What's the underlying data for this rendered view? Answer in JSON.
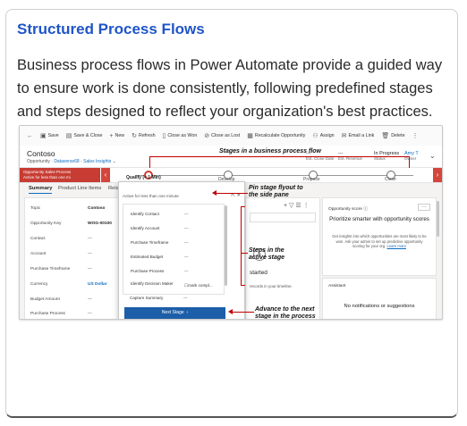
{
  "card": {
    "title": "Structured Process Flows",
    "body": "Business process flows in Power Automate provide a guided way to ensure work is done consistently, following predefined stages and steps designed to reflect your organization's best practices."
  },
  "commandbar": {
    "items": [
      "Save",
      "Save & Close",
      "New",
      "Refresh",
      "Close as Won",
      "Close as Lost",
      "Recalculate Opportunity",
      "Assign",
      "Email a Link",
      "Delete"
    ]
  },
  "record": {
    "name": "Contoso",
    "entity": "Opportunity",
    "form": "Dataverse68 - Sales Insights",
    "est_close_label": "Est. Close Date",
    "est_close_value": "---",
    "est_revenue_label": "Est. Revenue",
    "est_revenue_value": "---",
    "status_label": "Status",
    "status_value": "In Progress",
    "owner_label": "Owner",
    "owner_value": "Amy T"
  },
  "process": {
    "name": "Opportunity Sales Process",
    "active_time": "Active for less than one mi",
    "stages": [
      {
        "label": "Qualify (< 1 Min)",
        "active": true
      },
      {
        "label": "Develop",
        "active": false
      },
      {
        "label": "Propose",
        "active": false
      },
      {
        "label": "Close",
        "active": false
      }
    ]
  },
  "tabs": [
    "Summary",
    "Product Line Items",
    "Relate"
  ],
  "form_fields": [
    {
      "label": "Topic",
      "value": "Contoso"
    },
    {
      "label": "Opportunity Key",
      "value": "WOG-00100"
    },
    {
      "label": "Contact",
      "value": "---"
    },
    {
      "label": "Account",
      "value": "---"
    },
    {
      "label": "Purchase Timeframe",
      "value": "---"
    },
    {
      "label": "Currency",
      "value": "US Dollar"
    },
    {
      "label": "Budget Amount",
      "value": "---"
    },
    {
      "label": "Purchase Process",
      "value": "---"
    }
  ],
  "flyout": {
    "active_time": "Active for less than one minute",
    "steps": [
      {
        "label": "Identify Contact",
        "value": "---"
      },
      {
        "label": "Identify Account",
        "value": "---"
      },
      {
        "label": "Purchase Timeframe",
        "value": "---"
      },
      {
        "label": "Estimated Budget",
        "value": "---"
      },
      {
        "label": "Purchase Process",
        "value": "---"
      },
      {
        "label": "Identify Decision Maker",
        "value": "mark compl..."
      },
      {
        "label": "Capture Summary",
        "value": "---"
      }
    ],
    "next_button": "Next Stage"
  },
  "middle": {
    "started": "started",
    "records_text": "records in your timeline."
  },
  "right_panel": {
    "score_title": "Opportunity score",
    "headline": "Prioritize smarter with opportunity scores",
    "body": "Get insights into which opportunities are most likely to be won. Ask your admin to set up predictive opportunity scoring for your org.",
    "link": "Learn more",
    "assistant_title": "Assistant",
    "assistant_empty": "No notifications or suggestions"
  },
  "annotations": {
    "stages": "Stages in a business process flow",
    "pin": "Pin stage flyout to the side pane",
    "steps": "Steps in the active stage",
    "advance": "Advance to the next stage in the process"
  },
  "colors": {
    "accent": "#1f55c8",
    "process_red": "#c73c33",
    "annotation_red": "#c00000",
    "button_blue": "#1c5ea8"
  }
}
